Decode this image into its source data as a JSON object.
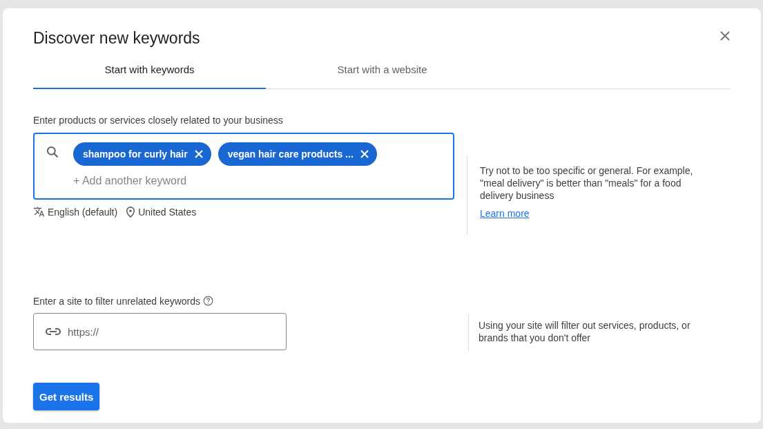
{
  "dialog": {
    "title": "Discover new keywords"
  },
  "tabs": [
    {
      "label": "Start with keywords",
      "selected": true
    },
    {
      "label": "Start with a website",
      "selected": false
    }
  ],
  "keywords": {
    "label": "Enter products or services closely related to your business",
    "chips": [
      "shampoo for curly hair",
      "vegan hair care products ..."
    ],
    "placeholder": "+ Add another keyword",
    "language": "English (default)",
    "location": "United States",
    "hint": "Try not to be too specific or general. For example, \"meal delivery\" is better than \"meals\" for a food delivery business",
    "link": "Learn more"
  },
  "site": {
    "label": "Enter a site to filter unrelated keywords",
    "placeholder": "https://",
    "hint": "Using your site will filter out services, products, or brands that you don't offer"
  },
  "button": "Get results"
}
